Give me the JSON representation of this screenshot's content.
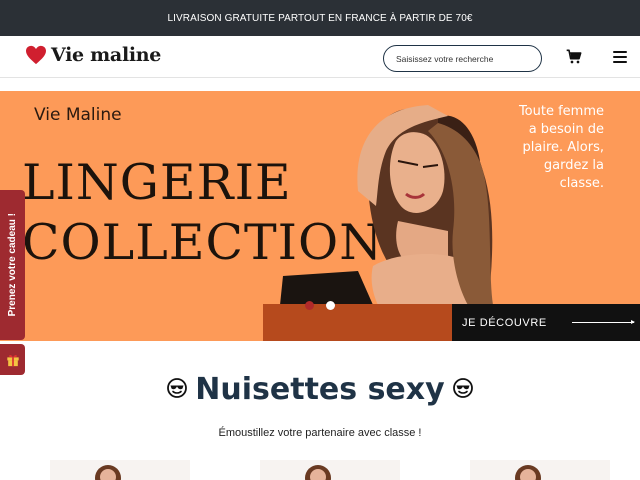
{
  "announcement": {
    "text": "LIVRAISON GRATUITE PARTOUT EN FRANCE À PARTIR DE 70€"
  },
  "header": {
    "brand": "Vie maline",
    "search_placeholder": "Saisissez votre recherche",
    "cart_icon": "cart-icon",
    "menu_icon": "hamburger-menu-icon"
  },
  "hero": {
    "brand": "Vie Maline",
    "title": "LINGERIE\nCOLLECTION",
    "tagline": "Toute femme a besoin de plaire. Alors, gardez la classe.",
    "cta_label": "JE DÉCOUVRE",
    "slides_total": 2,
    "active_slide": 2
  },
  "gift": {
    "label": "Prenez votre cadeau !",
    "icon": "gift-icon"
  },
  "section": {
    "title": "Nuisettes sexy",
    "title_icon": "smiling-face-with-sunglasses-icon",
    "subtitle": "Émoustillez votre partenaire avec classe !"
  },
  "colors": {
    "topbar": "#2b3036",
    "hero_bg": "#fd9a58",
    "gift_tab": "#9e2a30",
    "title": "#1f3346",
    "cta_bg": "#111111"
  }
}
